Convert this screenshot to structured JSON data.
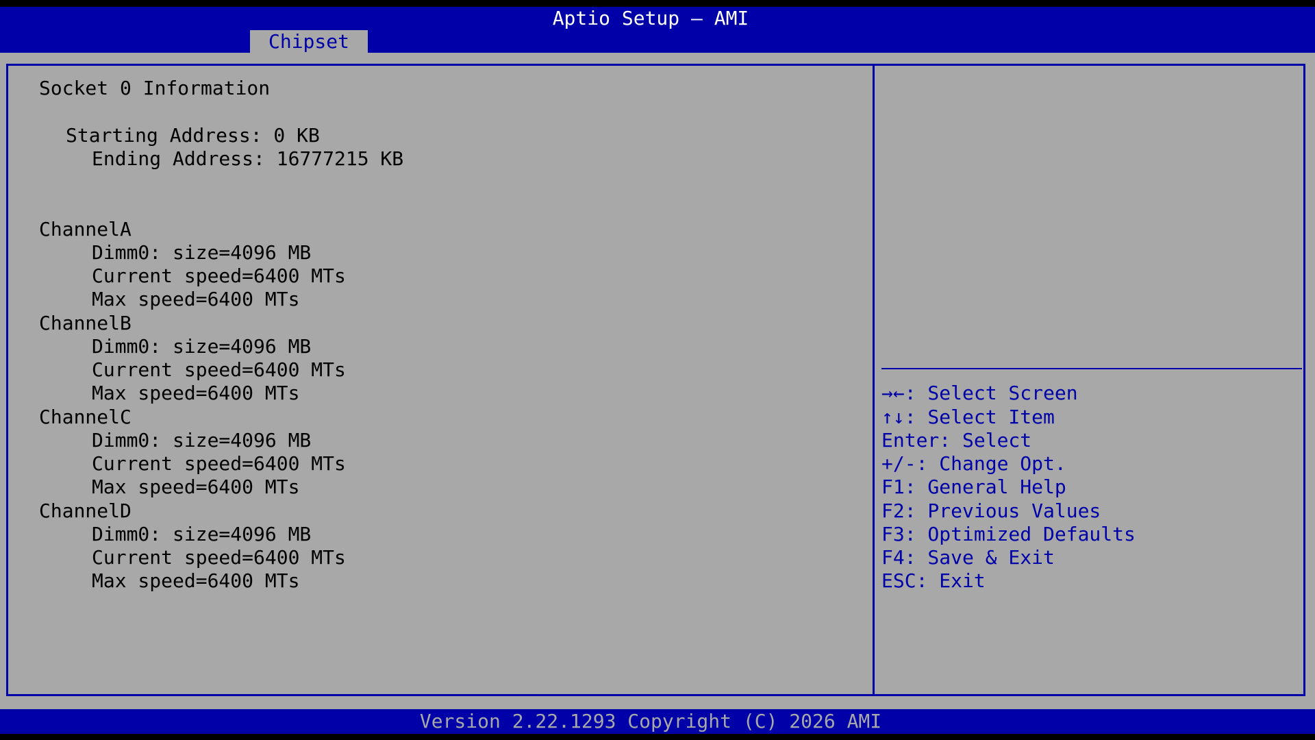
{
  "header": {
    "title": "Aptio Setup – AMI",
    "active_tab": "Chipset"
  },
  "main": {
    "section_title": "Socket 0 Information",
    "starting_address": "Starting Address: 0 KB",
    "ending_address": "Ending Address: 16777215 KB",
    "channels": [
      {
        "name": "ChannelA",
        "dimm": "Dimm0: size=4096 MB",
        "current_speed": "Current speed=6400 MTs",
        "max_speed": "Max speed=6400 MTs"
      },
      {
        "name": "ChannelB",
        "dimm": "Dimm0: size=4096 MB",
        "current_speed": "Current speed=6400 MTs",
        "max_speed": "Max speed=6400 MTs"
      },
      {
        "name": "ChannelC",
        "dimm": "Dimm0: size=4096 MB",
        "current_speed": "Current speed=6400 MTs",
        "max_speed": "Max speed=6400 MTs"
      },
      {
        "name": "ChannelD",
        "dimm": "Dimm0: size=4096 MB",
        "current_speed": "Current speed=6400 MTs",
        "max_speed": "Max speed=6400 MTs"
      }
    ]
  },
  "help": {
    "keys": [
      "→←: Select Screen",
      "↑↓: Select Item",
      "Enter: Select",
      "+/-: Change Opt.",
      "F1: General Help",
      "F2: Previous Values",
      "F3: Optimized Defaults",
      "F4: Save & Exit",
      "ESC: Exit"
    ]
  },
  "footer": {
    "version": "Version 2.22.1293 Copyright (C) 2026 AMI"
  },
  "colors": {
    "header_bg": "#0000a8",
    "panel_bg": "#a8a8a8",
    "text": "#000000",
    "help_text": "#0000a8"
  }
}
